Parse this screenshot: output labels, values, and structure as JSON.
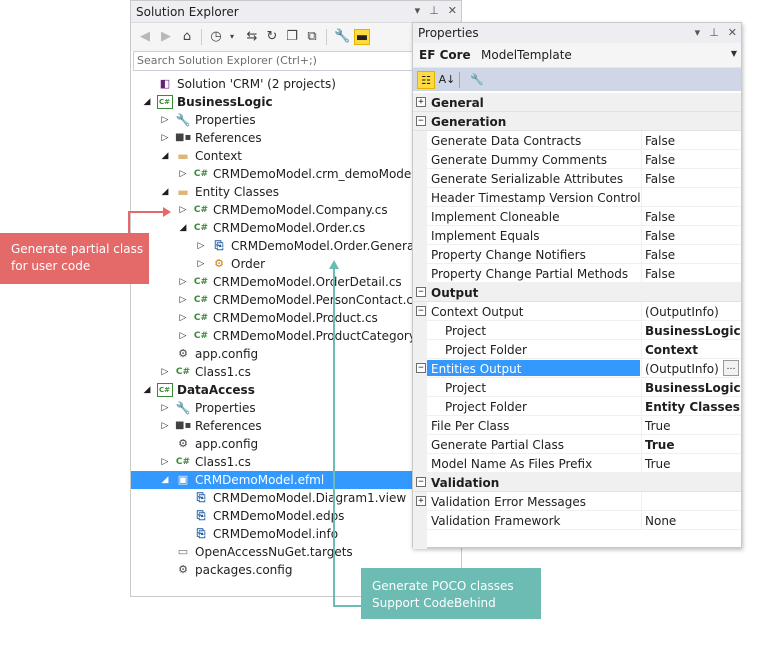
{
  "solution_explorer": {
    "title": "Solution Explorer",
    "search_placeholder": "Search Solution Explorer (Ctrl+;)",
    "tree": [
      {
        "label": "Solution 'CRM' (2 projects)",
        "icon": "solution-icon"
      },
      {
        "label": "BusinessLogic",
        "icon": "csproj-icon",
        "bold": true
      },
      {
        "label": "Properties",
        "icon": "wrench-icon"
      },
      {
        "label": "References",
        "icon": "references-icon"
      },
      {
        "label": "Context",
        "icon": "folder-icon"
      },
      {
        "label": "CRMDemoModel.crm_demoModel.c",
        "icon": "csharp-file-icon"
      },
      {
        "label": "Entity Classes",
        "icon": "folder-icon"
      },
      {
        "label": "CRMDemoModel.Company.cs",
        "icon": "csharp-file-icon"
      },
      {
        "label": "CRMDemoModel.Order.cs",
        "icon": "csharp-file-icon"
      },
      {
        "label": "CRMDemoModel.Order.Generate",
        "icon": "generated-file-icon"
      },
      {
        "label": "Order",
        "icon": "class-icon"
      },
      {
        "label": "CRMDemoModel.OrderDetail.cs",
        "icon": "csharp-file-icon"
      },
      {
        "label": "CRMDemoModel.PersonContact.cs",
        "icon": "csharp-file-icon"
      },
      {
        "label": "CRMDemoModel.Product.cs",
        "icon": "csharp-file-icon"
      },
      {
        "label": "CRMDemoModel.ProductCategory.c",
        "icon": "csharp-file-icon"
      },
      {
        "label": "app.config",
        "icon": "config-icon"
      },
      {
        "label": "Class1.cs",
        "icon": "csharp-file-icon"
      },
      {
        "label": "DataAccess",
        "icon": "csproj-icon",
        "bold": true
      },
      {
        "label": "Properties",
        "icon": "wrench-icon"
      },
      {
        "label": "References",
        "icon": "references-icon"
      },
      {
        "label": "app.config",
        "icon": "config-icon"
      },
      {
        "label": "Class1.cs",
        "icon": "csharp-file-icon"
      },
      {
        "label": "CRMDemoModel.efml",
        "icon": "efml-icon",
        "selected": true
      },
      {
        "label": "CRMDemoModel.Diagram1.view",
        "icon": "generated-file-icon"
      },
      {
        "label": "CRMDemoModel.edps",
        "icon": "generated-file-icon"
      },
      {
        "label": "CRMDemoModel.info",
        "icon": "generated-file-icon"
      },
      {
        "label": "OpenAccessNuGet.targets",
        "icon": "file-icon"
      },
      {
        "label": "packages.config",
        "icon": "config-icon"
      }
    ]
  },
  "properties": {
    "title": "Properties",
    "object_name": "EF Core",
    "object_type": "ModelTemplate",
    "rows": [
      {
        "name": "General",
        "value": "",
        "category": true
      },
      {
        "name": "Generation",
        "value": "",
        "category": true
      },
      {
        "name": "Generate Data Contracts",
        "value": "False"
      },
      {
        "name": "Generate Dummy Comments",
        "value": "False"
      },
      {
        "name": "Generate Serializable Attributes",
        "value": "False"
      },
      {
        "name": "Header Timestamp Version Control Tag",
        "value": ""
      },
      {
        "name": "Implement Cloneable",
        "value": "False"
      },
      {
        "name": "Implement Equals",
        "value": "False"
      },
      {
        "name": "Property Change Notifiers",
        "value": "False"
      },
      {
        "name": "Property Change Partial Methods",
        "value": "False"
      },
      {
        "name": "Output",
        "value": "",
        "category": true
      },
      {
        "name": "Context Output",
        "value": "(OutputInfo)"
      },
      {
        "name": "Project",
        "value": "BusinessLogic"
      },
      {
        "name": "Project Folder",
        "value": "Context"
      },
      {
        "name": "Entities Output",
        "value": "(OutputInfo)"
      },
      {
        "name": "Project",
        "value": "BusinessLogic"
      },
      {
        "name": "Project Folder",
        "value": "Entity Classes"
      },
      {
        "name": "File Per Class",
        "value": "True"
      },
      {
        "name": "Generate Partial Class",
        "value": "True"
      },
      {
        "name": "Model Name As Files Prefix",
        "value": "True"
      },
      {
        "name": "Validation",
        "value": "",
        "category": true
      },
      {
        "name": "Validation Error Messages",
        "value": ""
      },
      {
        "name": "Validation Framework",
        "value": "None"
      }
    ]
  },
  "callouts": {
    "partial_line1": "Generate partial class",
    "partial_line2": "for user code",
    "poco_line1": "Generate POCO classes",
    "poco_line2": "Support CodeBehind"
  },
  "colors": {
    "callout_red": "#e46a6a",
    "callout_teal": "#6cbcb4",
    "selection": "#3399ff"
  }
}
